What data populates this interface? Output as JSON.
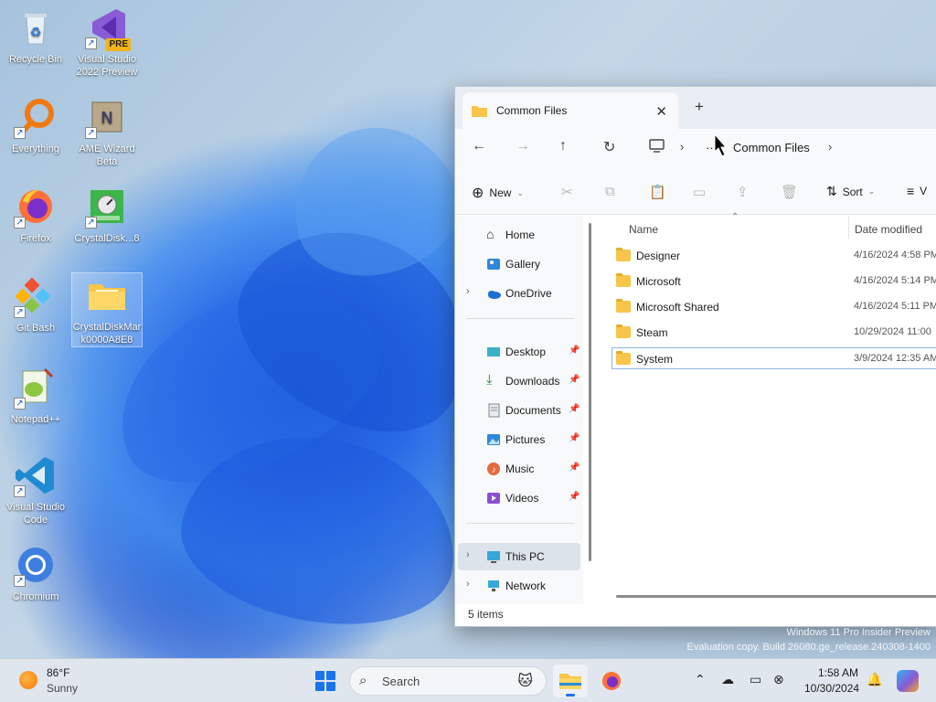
{
  "desktop": {
    "icons": [
      {
        "label": "Recycle Bin",
        "icon": "recycle-bin-icon"
      },
      {
        "label": "Visual Studio 2022 Preview",
        "badge": "PRE",
        "icon": "visual-studio-icon"
      },
      {
        "label": "Everything",
        "icon": "everything-search-icon"
      },
      {
        "label": "AME Wizard Beta",
        "icon": "ame-wizard-icon"
      },
      {
        "label": "Firefox",
        "icon": "firefox-icon"
      },
      {
        "label": "CrystalDisk...8",
        "icon": "crystaldisk-icon"
      },
      {
        "label": "Git Bash",
        "icon": "git-bash-icon"
      },
      {
        "label": "CrystalDiskMark0000A8E8",
        "icon": "folder-icon"
      },
      {
        "label": "Notepad++",
        "icon": "notepadpp-icon"
      },
      {
        "label": "Visual Studio Code",
        "icon": "vscode-icon"
      },
      {
        "label": "Chromium",
        "icon": "chromium-icon"
      }
    ]
  },
  "explorer": {
    "tab_title": "Common Files",
    "breadcrumb": {
      "more": "···",
      "current": "Common Files"
    },
    "toolbar": {
      "new_label": "New",
      "sort_label": "Sort",
      "view_label": "V"
    },
    "nav": {
      "home": "Home",
      "gallery": "Gallery",
      "onedrive": "OneDrive",
      "desktop": "Desktop",
      "downloads": "Downloads",
      "documents": "Documents",
      "pictures": "Pictures",
      "music": "Music",
      "videos": "Videos",
      "thispc": "This PC",
      "network": "Network"
    },
    "columns": {
      "name": "Name",
      "date": "Date modified"
    },
    "files": [
      {
        "name": "Designer",
        "date": "4/16/2024 4:58 PM"
      },
      {
        "name": "Microsoft",
        "date": "4/16/2024 5:14 PM"
      },
      {
        "name": "Microsoft Shared",
        "date": "4/16/2024 5:11 PM"
      },
      {
        "name": "Steam",
        "date": "10/29/2024 11:00"
      },
      {
        "name": "System",
        "date": "3/9/2024 12:35 AM"
      }
    ],
    "status": "5 items"
  },
  "watermark": {
    "line1": "Windows 11 Pro Insider Preview",
    "line2": "Evaluation copy. Build 26080.ge_release.240308-1400"
  },
  "taskbar": {
    "weather": {
      "temp": "86°F",
      "desc": "Sunny"
    },
    "search_placeholder": "Search",
    "clock": {
      "time": "1:58 AM",
      "date": "10/30/2024"
    }
  },
  "colors": {
    "accent": "#1a73e8",
    "folder": "#f6c54a"
  }
}
